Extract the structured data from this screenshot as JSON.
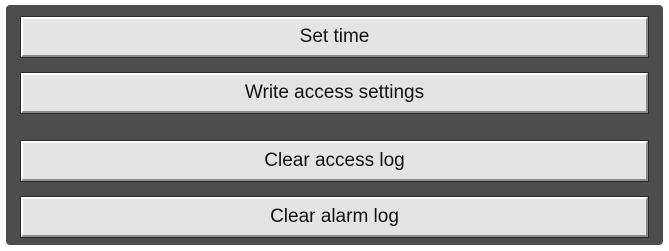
{
  "buttons": {
    "set_time": "Set time",
    "write_access_settings": "Write access settings",
    "clear_access_log": "Clear access log",
    "clear_alarm_log": "Clear alarm log"
  },
  "colors": {
    "panel_background": "#4d4d4d",
    "button_face": "#e4e4e4"
  }
}
